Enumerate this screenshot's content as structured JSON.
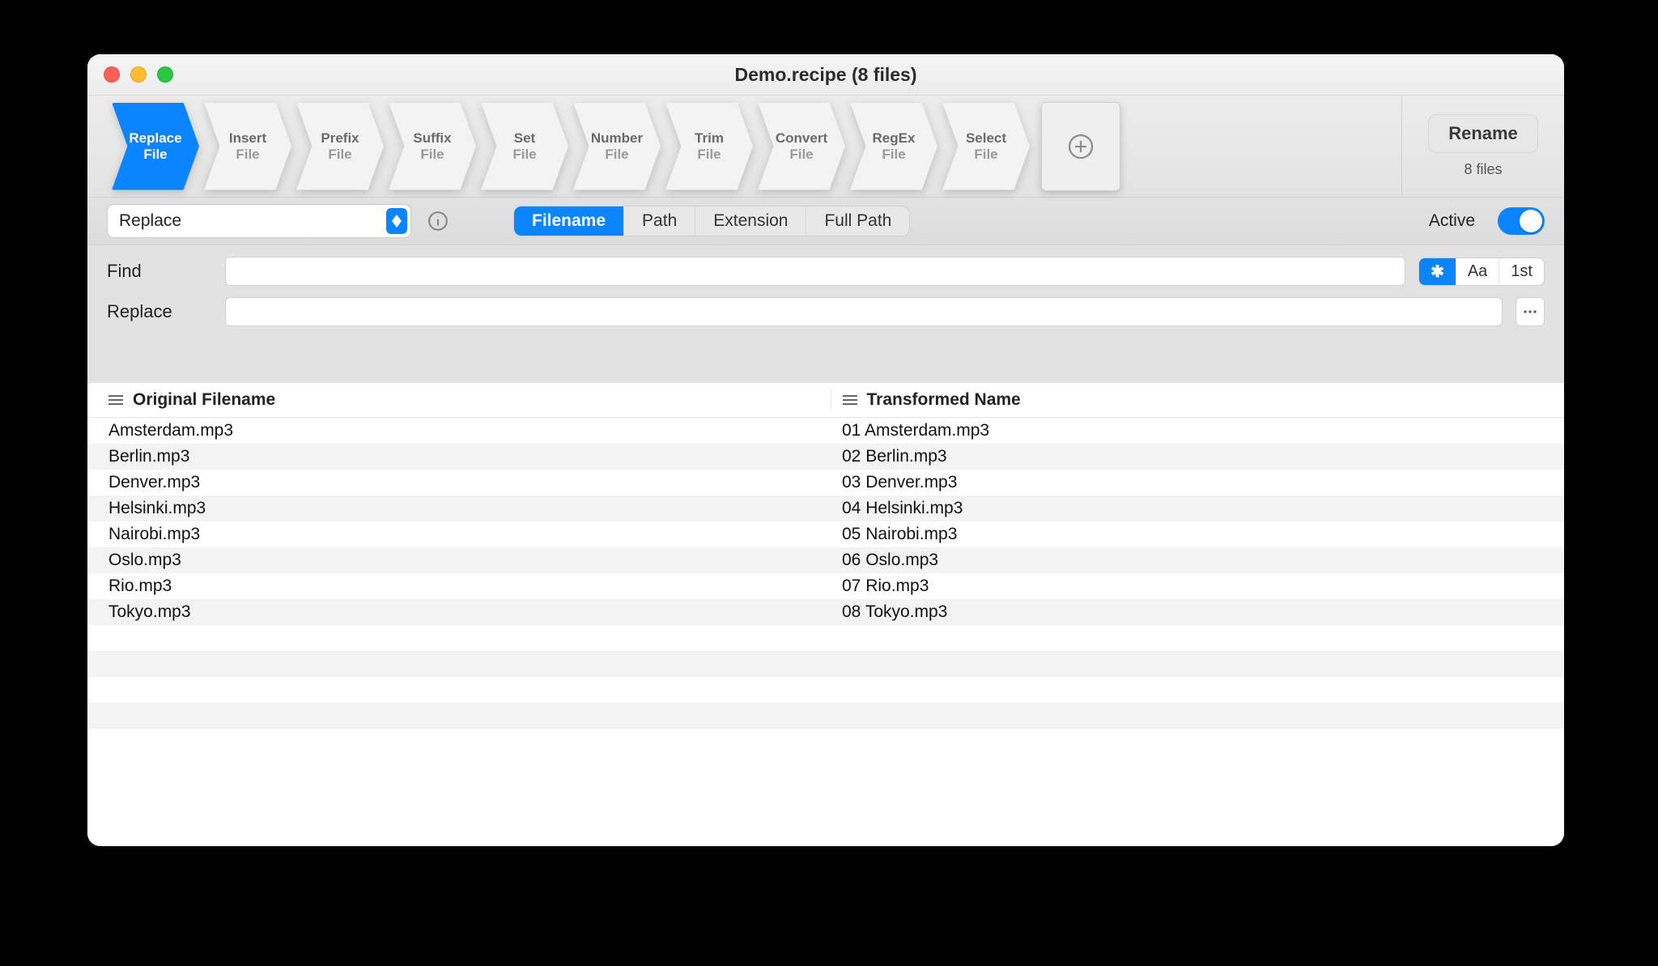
{
  "window_title": "Demo.recipe (8 files)",
  "actions": [
    {
      "top": "Replace",
      "bot": "File"
    },
    {
      "top": "Insert",
      "bot": "File"
    },
    {
      "top": "Prefix",
      "bot": "File"
    },
    {
      "top": "Suffix",
      "bot": "File"
    },
    {
      "top": "Set",
      "bot": "File"
    },
    {
      "top": "Number",
      "bot": "File"
    },
    {
      "top": "Trim",
      "bot": "File"
    },
    {
      "top": "Convert",
      "bot": "File"
    },
    {
      "top": "RegEx",
      "bot": "File"
    },
    {
      "top": "Select",
      "bot": "File"
    }
  ],
  "rename_label": "Rename",
  "files_count": "8 files",
  "dropdown_value": "Replace",
  "scope": {
    "filename": "Filename",
    "path": "Path",
    "extension": "Extension",
    "fullpath": "Full Path"
  },
  "active_label": "Active",
  "find_label": "Find",
  "replace_label": "Replace",
  "find_value": "",
  "replace_value": "",
  "option_wildcard": "✱",
  "option_case": "Aa",
  "option_first": "1st",
  "columns": {
    "original": "Original Filename",
    "transformed": "Transformed Name"
  },
  "rows": [
    {
      "orig": "Amsterdam.mp3",
      "trans": "01 Amsterdam.mp3"
    },
    {
      "orig": "Berlin.mp3",
      "trans": "02 Berlin.mp3"
    },
    {
      "orig": "Denver.mp3",
      "trans": "03 Denver.mp3"
    },
    {
      "orig": "Helsinki.mp3",
      "trans": "04 Helsinki.mp3"
    },
    {
      "orig": "Nairobi.mp3",
      "trans": "05 Nairobi.mp3"
    },
    {
      "orig": "Oslo.mp3",
      "trans": "06 Oslo.mp3"
    },
    {
      "orig": "Rio.mp3",
      "trans": "07 Rio.mp3"
    },
    {
      "orig": "Tokyo.mp3",
      "trans": "08 Tokyo.mp3"
    }
  ]
}
